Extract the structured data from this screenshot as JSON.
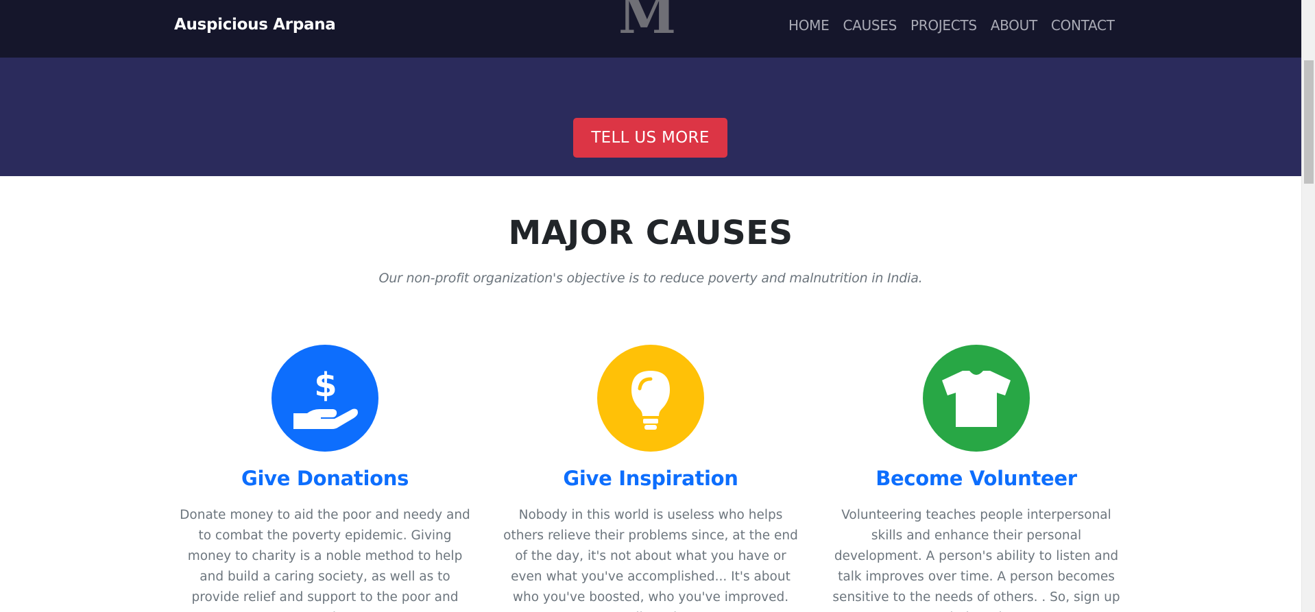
{
  "header": {
    "brand": "Auspicious Arpana",
    "logo_text": "M",
    "nav": [
      "HOME",
      "CAUSES",
      "PROJECTS",
      "ABOUT",
      "CONTACT"
    ]
  },
  "hero": {
    "cta_label": "TELL US MORE"
  },
  "causes": {
    "title": "MAJOR CAUSES",
    "subtitle": "Our non-profit organization's objective is to reduce poverty and malnutrition in India.",
    "cards": [
      {
        "icon": "hand-holding-dollar-icon",
        "color": "#0d6efd",
        "title": "Give Donations",
        "text": "Donate money to aid the poor and needy and to combat the poverty epidemic. Giving money to charity is a noble method to help and build a caring society, as well as to provide relief and support to the poor and needy."
      },
      {
        "icon": "lightbulb-icon",
        "color": "#ffc107",
        "title": "Give Inspiration",
        "text": "Nobody in this world is useless who helps others relieve their problems since, at the end of the day, it's not about what you have or even what you've accomplished... It's about who you've boosted, who you've improved. So, tell us about"
      },
      {
        "icon": "tshirt-icon",
        "color": "#28a745",
        "title": "Become Volunteer",
        "text": "Volunteering teaches people interpersonal skills and enhance their personal development. A person's ability to listen and talk improves over time. A person becomes sensitive to the needs of others. . So, sign up to help today."
      }
    ]
  }
}
